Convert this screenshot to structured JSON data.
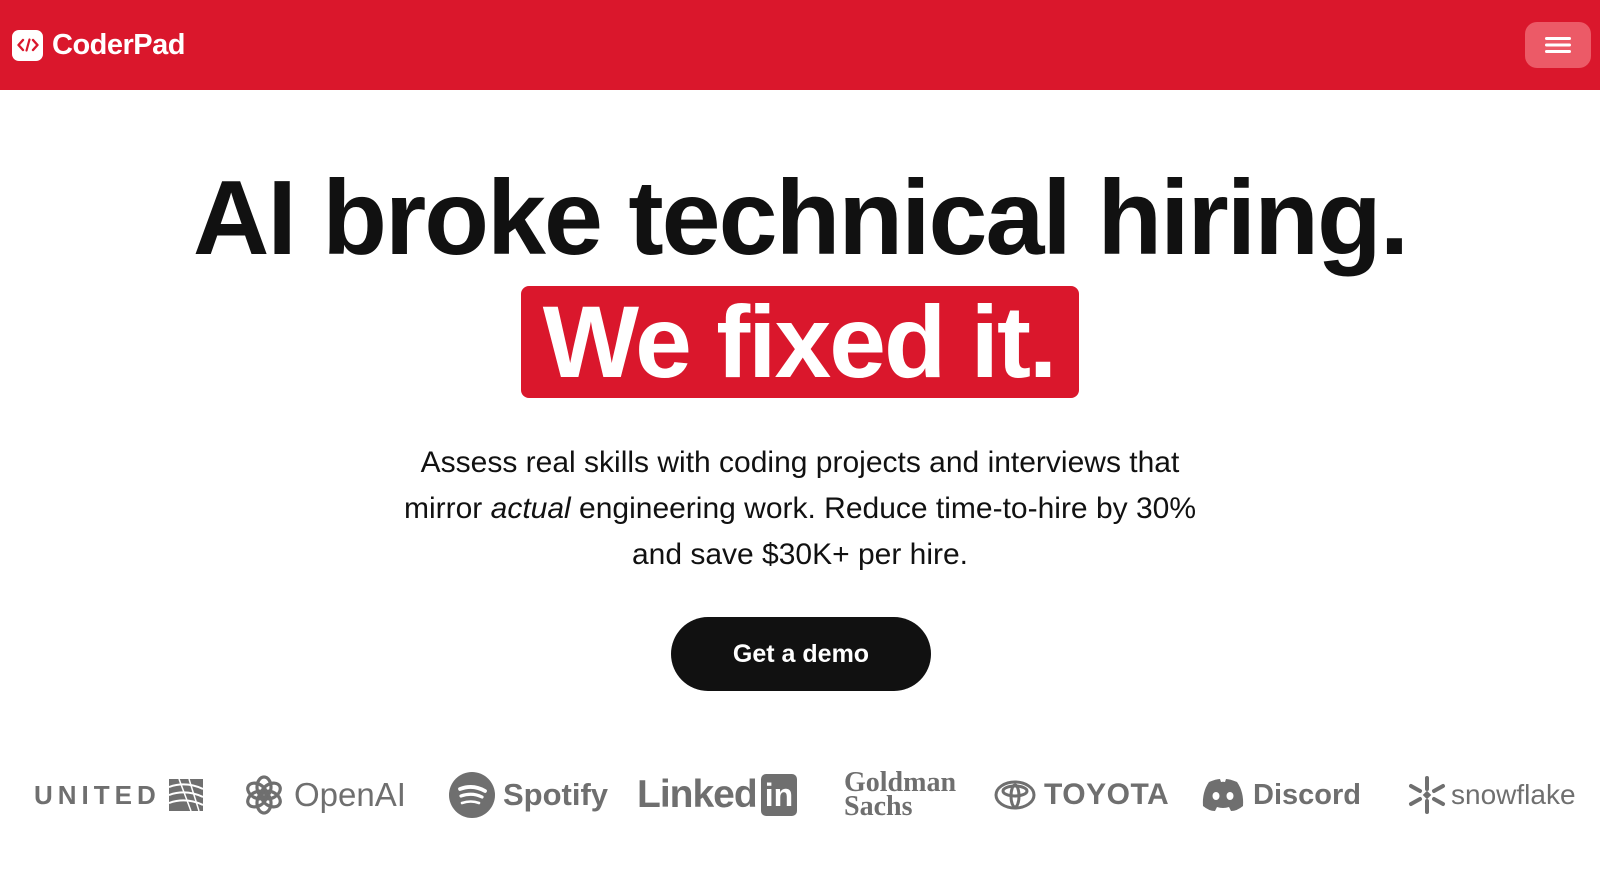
{
  "nav": {
    "brand": "CoderPad",
    "brand_icon": "code-brackets-icon",
    "menu_icon": "hamburger-menu-icon"
  },
  "hero": {
    "headline": "AI broke technical hiring.",
    "highlight": "We fixed it.",
    "sub_part1": "Assess real skills with coding projects and interviews that mirror ",
    "sub_emphasis": "actual",
    "sub_part2": " engineering work. Reduce time-to-hire by 30% and save $30K+ per hire.",
    "cta": "Get a demo"
  },
  "logos": {
    "united": "UNITED",
    "openai": "OpenAI",
    "spotify": "Spotify",
    "linkedin_text": "Linked",
    "linkedin_in": "in",
    "goldman_line1": "Goldman",
    "goldman_line2": "Sachs",
    "toyota": "TOYOTA",
    "discord": "Discord",
    "snowflake": "snowflake"
  },
  "colors": {
    "brand_red": "#da172c",
    "dark": "#111111",
    "logo_gray": "#6f6f6f"
  }
}
